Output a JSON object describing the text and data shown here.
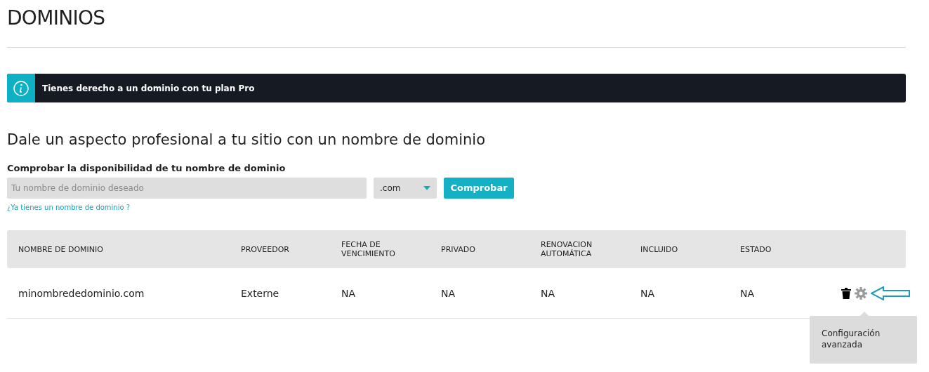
{
  "page_title": "DOMINIOS",
  "notice": {
    "text": "Tienes derecho a un dominio con tu plan Pro"
  },
  "heading": "Dale un aspecto profesional a tu sitio con un nombre de dominio",
  "search": {
    "label": "Comprobar la disponibilidad de tu nombre de dominio",
    "placeholder": "Tu nombre de dominio deseado",
    "extension": ".com",
    "button": "Comprobar",
    "link": "¿Ya tienes un nombre de dominio ?"
  },
  "table": {
    "columns": [
      "NOMBRE DE DOMINIO",
      "PROVEEDOR",
      "FECHA DE VENCIMIENTO",
      "PRIVADO",
      "RENOVACION AUTOMÁTICA",
      "INCLUIDO",
      "ESTADO"
    ],
    "rows": [
      {
        "cells": [
          "minombrededominio.com",
          "Externe",
          "NA",
          "NA",
          "NA",
          "NA",
          "NA"
        ]
      }
    ]
  },
  "tooltip": "Configuración avanzada"
}
